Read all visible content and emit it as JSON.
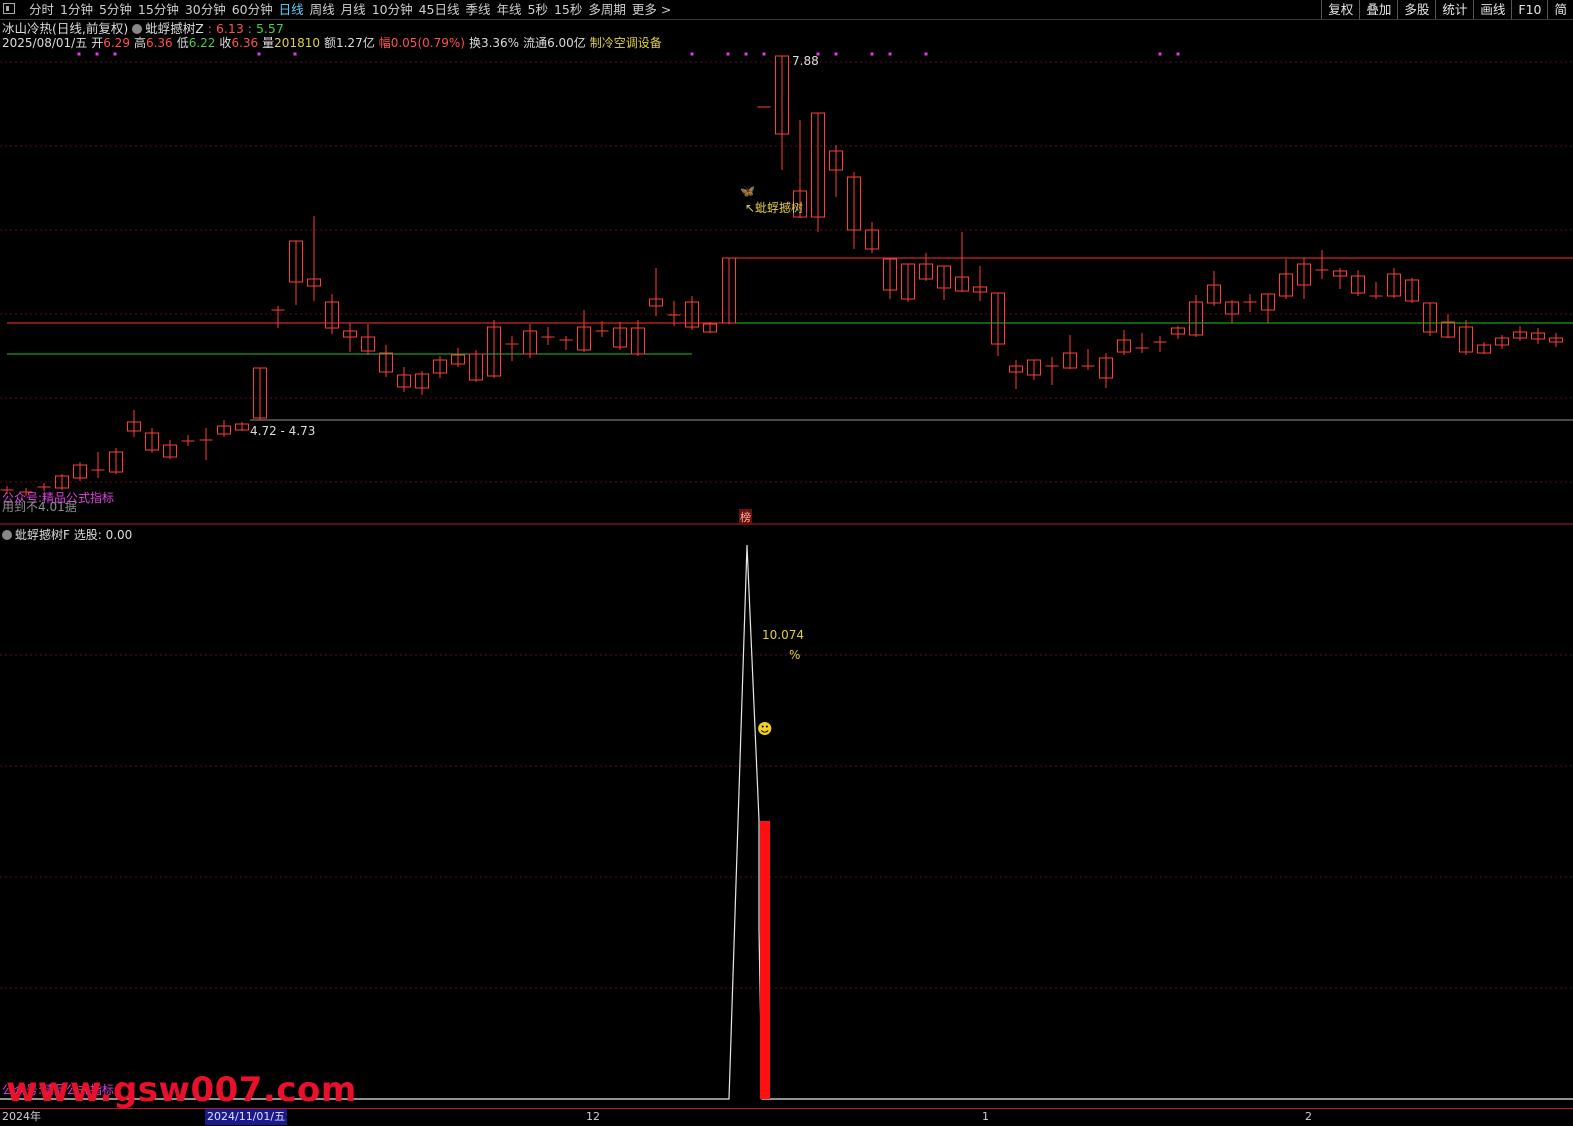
{
  "toolbar": {
    "tabs": [
      "分时",
      "1分钟",
      "5分钟",
      "15分钟",
      "30分钟",
      "60分钟",
      "日线",
      "周线",
      "月线",
      "10分钟",
      "45日线",
      "季线",
      "年线",
      "5秒",
      "15秒",
      "多周期",
      "更多 >"
    ],
    "active_tab": "日线",
    "right_tools": [
      "复权",
      "叠加",
      "多股",
      "统计",
      "画线",
      "F10",
      "简"
    ]
  },
  "header": {
    "stock_title": "冰山冷热(日线,前复权)",
    "indicator_name": "蚍蜉撼树Z",
    "indicator_v1": ": 6.13",
    "indicator_v2": ": 5.57"
  },
  "quote": {
    "date": "2025/08/01/五",
    "open_label": "开",
    "open": "6.29",
    "high_label": "高",
    "high": "6.36",
    "low_label": "低",
    "low": "6.22",
    "close_label": "收",
    "close": "6.36",
    "vol_label": "量",
    "volume": "201810",
    "amount": "额1.27亿",
    "change": "幅0.05(0.79%)",
    "turnover": "换3.36%",
    "float": "流通6.00亿",
    "industry": "制冷空调设备"
  },
  "main_chart": {
    "price_high_label": "7.88",
    "range_label": "4.72 - 4.73",
    "signal_label": "↖蚍蜉撼树",
    "bottom_label": "公众号:精品公式指标",
    "bottom_label2": "用到不4.01据",
    "badge": "榜"
  },
  "sub_chart": {
    "title": "蚍蜉撼树F",
    "value": "选股: 0.00",
    "peak_value": "10.074",
    "peak_unit": "%",
    "bottom_label": "公众号:精品公式指标"
  },
  "watermark": "www.gsw007.com",
  "x_axis": [
    "2024年",
    "2024/11/01/五",
    "12",
    "1",
    "2"
  ],
  "colors": {
    "up": "#ff3c3c",
    "down": "#54ffff",
    "green_line": "#20c020",
    "red_line": "#ff3030"
  }
}
